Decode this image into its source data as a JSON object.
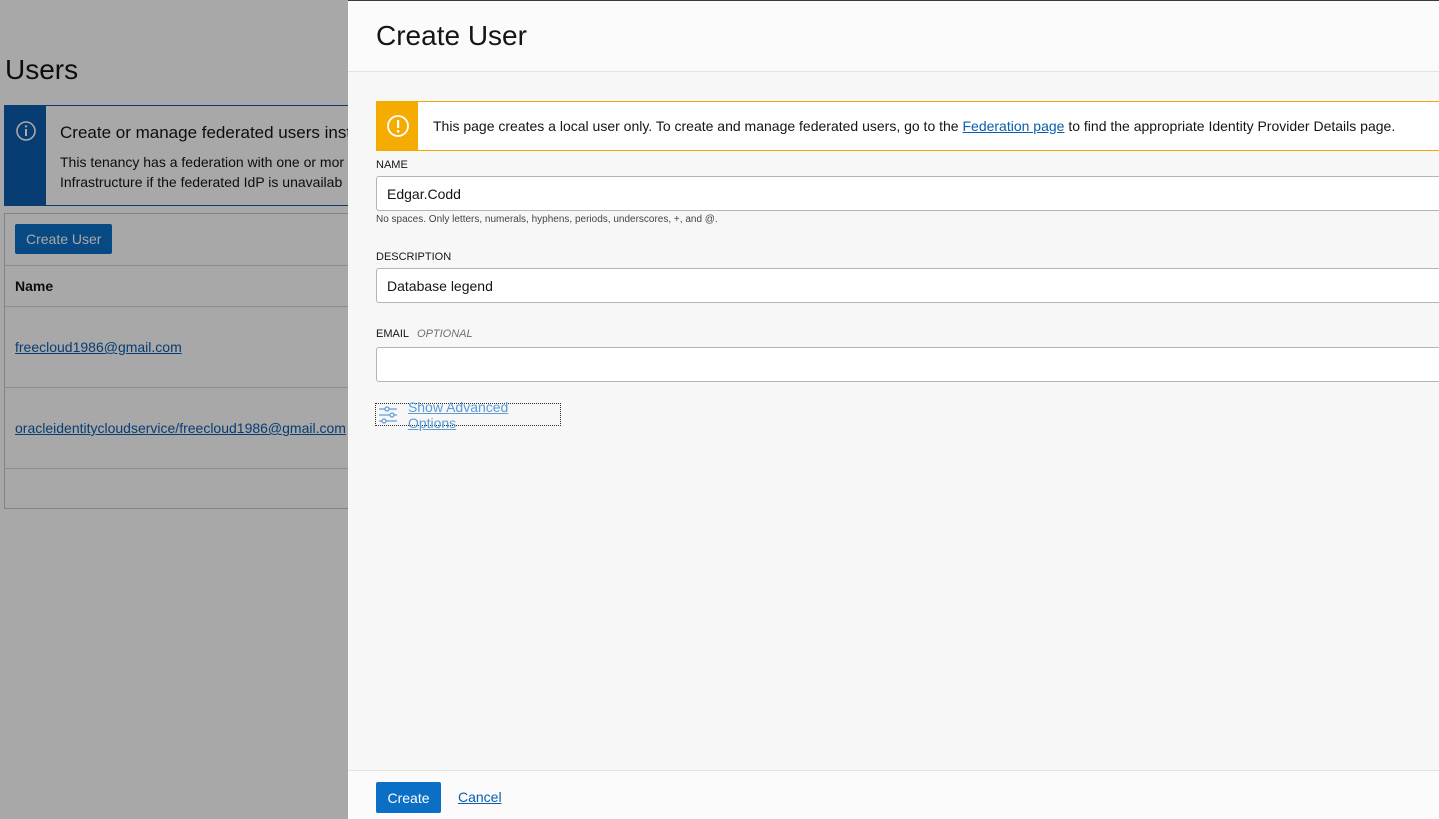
{
  "background": {
    "page_title": "Users",
    "info": {
      "heading": "Create or manage federated users inst",
      "text_line1": "This tenancy has a federation with one or mor",
      "text_line2": "Infrastructure if the federated IdP is unavailab"
    },
    "table": {
      "create_button": "Create User",
      "column_name": "Name",
      "rows": [
        "freecloud1986@gmail.com",
        "oracleidentitycloudservice/freecloud1986@gmail.com"
      ]
    }
  },
  "drawer": {
    "title": "Create User",
    "warning": {
      "prefix": "This page creates a local user only. To create and manage federated users, go to the",
      "link": "Federation page",
      "suffix": "to find the appropriate Identity Provider Details page."
    },
    "name": {
      "label": "NAME",
      "value": "Edgar.Codd",
      "help": "No spaces. Only letters, numerals, hyphens, periods, underscores, +, and @."
    },
    "description": {
      "label": "DESCRIPTION",
      "value": "Database legend"
    },
    "email": {
      "label": "EMAIL",
      "optional": "OPTIONAL",
      "value": ""
    },
    "advanced_link": "Show Advanced Options",
    "footer": {
      "create": "Create",
      "cancel": "Cancel"
    }
  },
  "colors": {
    "primary": "#0b6fc6",
    "link": "#0b5dae",
    "warning": "#f5ab00",
    "info": "#0b5dae"
  }
}
